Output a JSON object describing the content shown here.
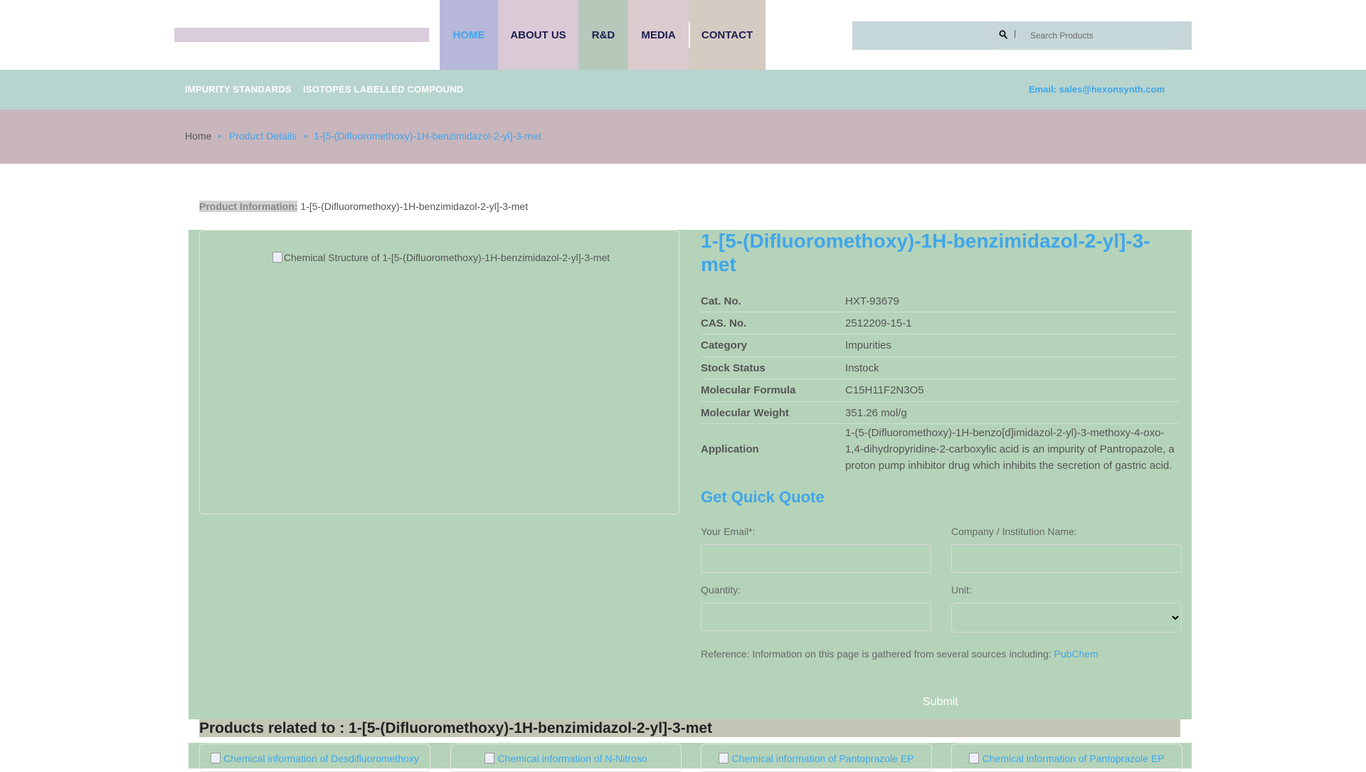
{
  "header": {
    "nav": [
      "HOME",
      "ABOUT US",
      "R&D",
      "MEDIA",
      "CONTACT"
    ],
    "search_placeholder": "Search Products",
    "search_separator": "|"
  },
  "subnav": {
    "links": [
      "IMPURITY STANDARDS",
      "ISOTOPES LABELLED COMPOUND"
    ],
    "email": "Email: sales@hexonsynth.com"
  },
  "breadcrumb": {
    "home": "Home",
    "details": "Product Details",
    "current": "1-[5-(Difluoromethoxy)-1H-benzimidazol-2-yl]-3-met"
  },
  "product": {
    "info_label": "Product Information:",
    "info_name": "1-[5-(Difluoromethoxy)-1H-benzimidazol-2-yl]-3-met",
    "image_alt": "Chemical Structure of 1-[5-(Difluoromethoxy)-1H-benzimidazol-2-yl]-3-met",
    "title": "1-[5-(Difluoromethoxy)-1H-benzimidazol-2-yl]-3-met",
    "specs": [
      {
        "label": "Cat. No.",
        "value": "HXT-93679"
      },
      {
        "label": "CAS. No.",
        "value": "2512209-15-1"
      },
      {
        "label": "Category",
        "value": "Impurities"
      },
      {
        "label": "Stock Status",
        "value": "Instock"
      },
      {
        "label": "Molecular Formula",
        "value": "C15H11F2N3O5"
      },
      {
        "label": "Molecular Weight",
        "value": "351.26 mol/g"
      },
      {
        "label": "Application",
        "value": "1-(5-(Difluoromethoxy)-1H-benzo[d]imidazol-2-yl)-3-methoxy-4-oxo-1,4-dihydropyridine-2-carboxylic acid is an impurity of Pantropazole, a proton pump inhibitor drug which inhibits the secretion of gastric acid."
      }
    ]
  },
  "quote": {
    "heading": "Get Quick Quote",
    "email_label": "Your Email*:",
    "company_label": "Company / Institution Name:",
    "quantity_label": "Quantity:",
    "unit_label": "Unit:",
    "reference_text": "Reference: Information on this page is gathered from several sources including:",
    "reference_link": "PubChem",
    "submit": "Submit"
  },
  "related": {
    "heading": "Products related to : 1-[5-(Difluoromethoxy)-1H-benzimidazol-2-yl]-3-met",
    "items": [
      "Chemical information of Desdifluoromethoxy",
      "Chemical information of N-Nitroso",
      "Chemical information of Pantoprazole EP",
      "Chemical information of Pantoprazole EP"
    ]
  }
}
